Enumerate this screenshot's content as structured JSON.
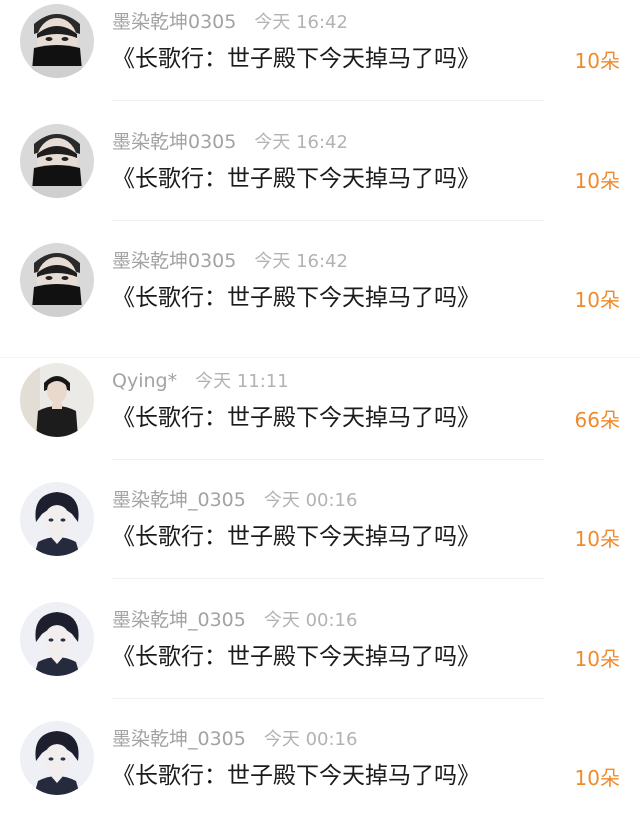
{
  "comments": [
    {
      "user": "墨染乾坤0305",
      "time": "今天 16:42",
      "content": "《长歌行：世子殿下今天掉马了吗》",
      "gift": "10朵",
      "avatar_icon": "man-in-black-mask-avatar-icon"
    },
    {
      "user": "墨染乾坤0305",
      "time": "今天 16:42",
      "content": "《长歌行：世子殿下今天掉马了吗》",
      "gift": "10朵",
      "avatar_icon": "man-in-black-mask-avatar-icon"
    },
    {
      "user": "墨染乾坤0305",
      "time": "今天 16:42",
      "content": "《长歌行：世子殿下今天掉马了吗》",
      "gift": "10朵",
      "avatar_icon": "man-in-black-mask-avatar-icon"
    },
    {
      "user": "Qying*",
      "time": "今天 11:11",
      "content": "《长歌行：世子殿下今天掉马了吗》",
      "gift": "66朵",
      "avatar_icon": "man-in-black-jacket-avatar-icon"
    },
    {
      "user": "墨染乾坤_0305",
      "time": "今天 00:16",
      "content": "《长歌行：世子殿下今天掉马了吗》",
      "gift": "10朵",
      "avatar_icon": "anime-boy-avatar-icon"
    },
    {
      "user": "墨染乾坤_0305",
      "time": "今天 00:16",
      "content": "《长歌行：世子殿下今天掉马了吗》",
      "gift": "10朵",
      "avatar_icon": "anime-boy-avatar-icon"
    },
    {
      "user": "墨染乾坤_0305",
      "time": "今天 00:16",
      "content": "《长歌行：世子殿下今天掉马了吗》",
      "gift": "10朵",
      "avatar_icon": "anime-boy-avatar-icon"
    }
  ],
  "colors": {
    "gift": "#f08a2b",
    "username": "#a3a3a3",
    "content": "#1b1b1b"
  }
}
